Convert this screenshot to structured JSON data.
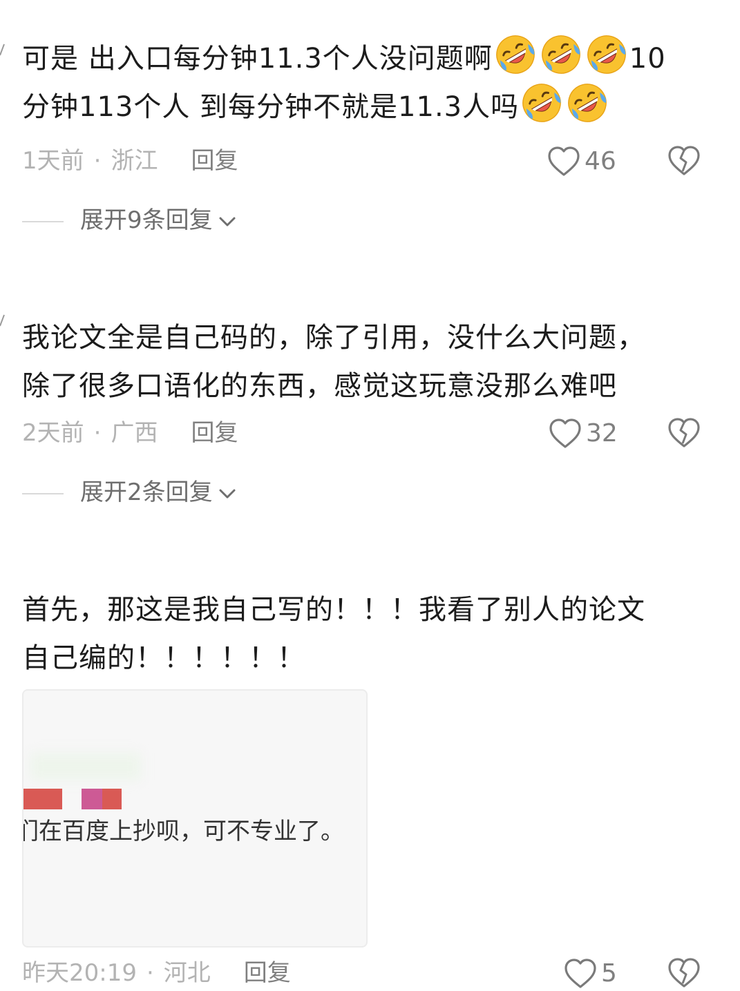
{
  "comments": [
    {
      "lines": [
        [
          "可是 出入口每分钟11.3个人没问题啊",
          "emoji",
          "emoji",
          "emoji",
          "10"
        ],
        [
          "分钟113个人  到每分钟不就是11.3人吗",
          "emoji",
          "emoji"
        ]
      ],
      "time": "1天前",
      "location": "浙江",
      "reply_label": "回复",
      "likes": "46",
      "expand_label": "展开9条回复"
    },
    {
      "lines": [
        [
          "我论文全是自己码的，除了引用，没什么大问题，"
        ],
        [
          "除了很多口语化的东西，感觉这玩意没那么难吧"
        ]
      ],
      "time": "2天前",
      "location": "广西",
      "reply_label": "回复",
      "likes": "32",
      "expand_label": "展开2条回复"
    },
    {
      "lines": [
        [
          "首先，那这是我自己写的！！！我看了别人的论文"
        ],
        [
          "自己编的！！！！！！"
        ]
      ],
      "attached_image_text": "们在百度上抄呗，可不专业了。",
      "time": "昨天20:19",
      "location": "河北",
      "reply_label": "回复",
      "likes": "5"
    }
  ],
  "separator": "·",
  "icons": {
    "like": "heart-outline-icon",
    "dislike": "broken-heart-icon",
    "expand": "chevron-down-icon",
    "emoji": "rolling-on-floor-laughing-emoji"
  }
}
